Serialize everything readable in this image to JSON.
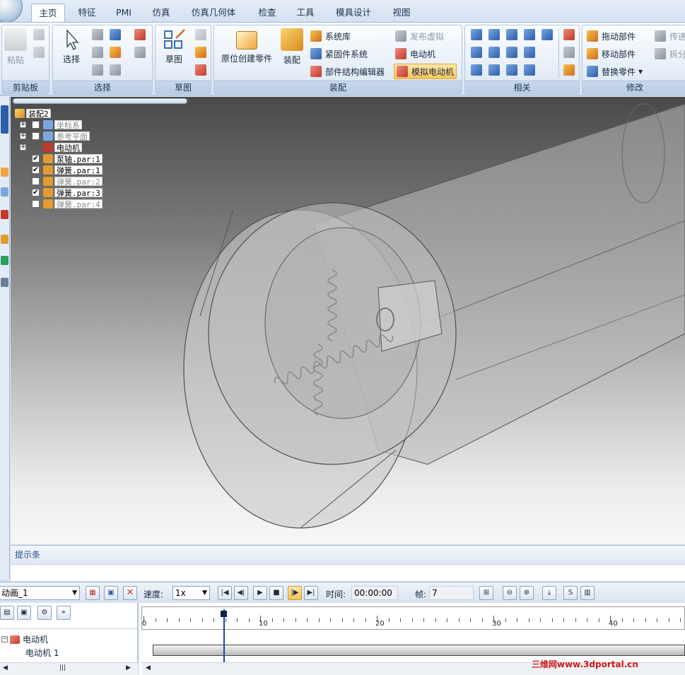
{
  "ribbon": {
    "tabs": [
      "主页",
      "特征",
      "PMI",
      "仿真",
      "仿真几何体",
      "检查",
      "工具",
      "模具设计",
      "视图"
    ],
    "active_tab": "主页",
    "groups": {
      "clipboard": {
        "label": "剪贴板",
        "paste": "粘贴"
      },
      "select": {
        "label": "选择",
        "select": "选择"
      },
      "sketch": {
        "label": "草图",
        "sketch": "草图"
      },
      "assembly": {
        "label": "装配",
        "create_in_place": "原位创建零件",
        "assemble": "装配",
        "library": "系统库",
        "fastener": "紧固件系统",
        "structure_editor": "部件结构编辑器",
        "publish_virtual": "发布虚拟",
        "motor": "电动机",
        "simulate_motor": "模拟电动机"
      },
      "relate": {
        "label": "相关"
      },
      "modify": {
        "label": "修改",
        "drag": "拖动部件",
        "move": "移动部件",
        "replace": "替换零件",
        "transfer": "传递",
        "disperse": "拆分"
      }
    }
  },
  "tree": {
    "root": "装配2",
    "items": [
      {
        "label": "坐标系",
        "checked": false,
        "dim": true,
        "expand": "+"
      },
      {
        "label": "参考平面",
        "checked": false,
        "dim": true,
        "expand": "+"
      },
      {
        "label": "电动机",
        "checked": null,
        "dim": false,
        "expand": "+"
      },
      {
        "label": "泵轴.par:1",
        "checked": true,
        "dim": false,
        "expand": ""
      },
      {
        "label": "弹簧.par:1",
        "checked": true,
        "dim": false,
        "expand": ""
      },
      {
        "label": "弹簧.par:2",
        "checked": false,
        "dim": true,
        "expand": ""
      },
      {
        "label": "弹簧.par:3",
        "checked": true,
        "dim": false,
        "expand": ""
      },
      {
        "label": "弹簧.par:4",
        "checked": false,
        "dim": true,
        "expand": ""
      }
    ]
  },
  "prompt": {
    "label": "提示条"
  },
  "animation": {
    "name": "动画_1",
    "speed_label": "速度:",
    "speed": "1x",
    "time_label": "时间:",
    "time": "00:00:00",
    "frame_label": "帧:",
    "frame": "7"
  },
  "timeline": {
    "ticks": [
      "0",
      "10",
      "20",
      "30",
      "40"
    ],
    "current_frame": 7,
    "tree_parent": "电动机",
    "tree_child": "电动机 1"
  },
  "watermark": "三维网www.3dportal.cn"
}
